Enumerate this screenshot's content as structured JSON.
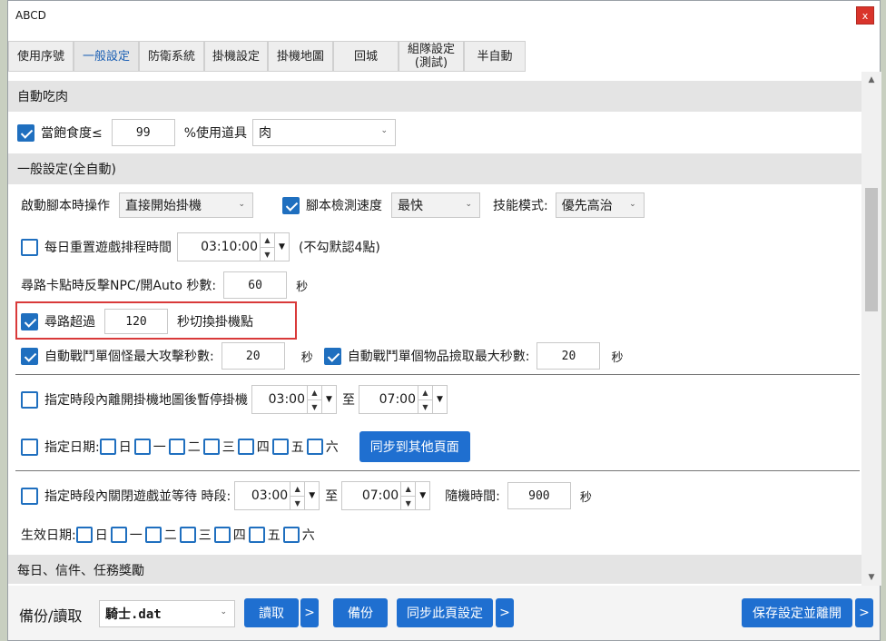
{
  "window": {
    "title": "ABCD",
    "close_label": "x"
  },
  "tabs": [
    {
      "label": "使用序號"
    },
    {
      "label": "一般設定"
    },
    {
      "label": "防衛系統"
    },
    {
      "label": "掛機設定"
    },
    {
      "label": "掛機地圖"
    },
    {
      "label": "回城"
    },
    {
      "label": "組隊設定\n(測試)"
    },
    {
      "label": "半自動"
    }
  ],
  "sections": {
    "auto_eat": "自動吃肉",
    "general": "一般設定(全自動)",
    "daily": "每日、信件、任務獎勵"
  },
  "auto_eat": {
    "label": "當飽食度≤",
    "value": "99",
    "unit_label": "%使用道具",
    "item": "肉"
  },
  "general": {
    "start_label": "啟動腳本時操作",
    "start_value": "直接開始掛機",
    "detect_speed_label": "腳本檢測速度",
    "detect_speed_value": "最快",
    "skill_mode_label": "技能模式:",
    "skill_mode_value": "優先高治",
    "daily_reset_label": "每日重置遊戲排程時間",
    "daily_reset_time": "03:10:00",
    "daily_reset_note": "(不勾默認4點)",
    "stuck_label": "尋路卡點時反擊NPC/開Auto 秒數:",
    "stuck_value": "60",
    "stuck_unit": "秒",
    "path_label": "尋路超過",
    "path_value": "120",
    "path_unit": "秒切換掛機點",
    "fight_label": "自動戰鬥單個怪最大攻擊秒數:",
    "fight_value": "20",
    "fight_unit": "秒",
    "loot_label": "自動戰鬥單個物品撿取最大秒數:",
    "loot_value": "20",
    "loot_unit": "秒",
    "pause_label": "指定時段內離開掛機地圖後暫停掛機",
    "pause_from": "03:00",
    "pause_to_label": "至",
    "pause_to": "07:00",
    "date_label": "指定日期:",
    "days": [
      "日",
      "一",
      "二",
      "三",
      "四",
      "五",
      "六"
    ],
    "sync_button": "同步到其他頁面",
    "close_game_label": "指定時段內關閉遊戲並等待 時段:",
    "close_from": "03:00",
    "close_to_label": "至",
    "close_to": "07:00",
    "random_label": "隨機時間:",
    "random_value": "900",
    "random_unit": "秒",
    "effective_label": "生效日期:"
  },
  "bottom": {
    "backup_label": "備份/讀取",
    "file_value": "騎士.dat",
    "read_button": "讀取",
    "more_1": ">",
    "backup_button": "備份",
    "sync_page_button": "同步此頁設定",
    "more_2": ">",
    "save_button": "保存設定並離開",
    "more_3": ">"
  }
}
